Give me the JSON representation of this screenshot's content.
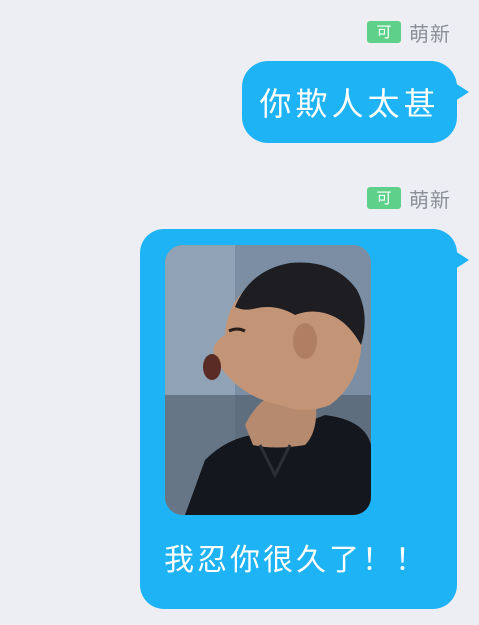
{
  "messages": [
    {
      "sender": {
        "badge": "可",
        "name": "萌新"
      },
      "text": "你欺人太甚"
    },
    {
      "sender": {
        "badge": "可",
        "name": "萌新"
      },
      "image": {
        "subject": "man-shouting"
      },
      "caption": "我忍你很久了！！"
    }
  ],
  "colors": {
    "background": "#eceef4",
    "bubble": "#1eb3f5",
    "badge": "#5fd08a",
    "sender_name": "#8c8f99",
    "text": "#ffffff"
  }
}
